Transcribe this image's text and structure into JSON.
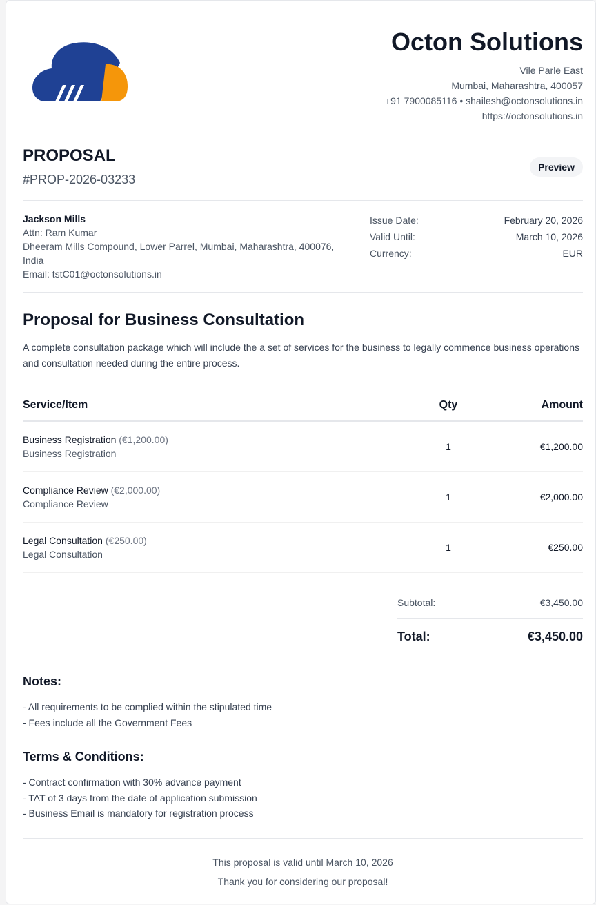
{
  "company": {
    "name": "Octon Solutions",
    "address_line1": "Vile Parle East",
    "address_line2": "Mumbai, Maharashtra, 400057",
    "contact": "+91 7900085116 • shailesh@octonsolutions.in",
    "website": "https://octonsolutions.in",
    "logo_colors": {
      "blue": "#1f4194",
      "orange": "#f5960a"
    }
  },
  "document": {
    "title": "PROPOSAL",
    "number": "#PROP-2026-03233",
    "status_badge": "Preview"
  },
  "client": {
    "name": "Jackson Mills",
    "attn": "Attn: Ram Kumar",
    "address_line1": "Dheeram Mills Compound, Lower Parrel, Mumbai, Maharashtra, 400076,",
    "address_line2": "India",
    "email": "Email: tstC01@octonsolutions.in"
  },
  "meta": [
    {
      "label": "Issue Date:",
      "value": "February 20, 2026"
    },
    {
      "label": "Valid Until:",
      "value": "March 10, 2026"
    },
    {
      "label": "Currency:",
      "value": "EUR"
    }
  ],
  "proposal": {
    "title": "Proposal for Business Consultation",
    "description": "A complete consultation package which will include the a set of services for the business to legally commence business operations and consultation needed during the entire process."
  },
  "items_table": {
    "headers": {
      "item": "Service/Item",
      "qty": "Qty",
      "amount": "Amount"
    },
    "rows": [
      {
        "name": "Business Registration",
        "price": "(€1,200.00)",
        "description": "Business Registration",
        "qty": "1",
        "amount": "€1,200.00"
      },
      {
        "name": "Compliance Review",
        "price": "(€2,000.00)",
        "description": "Compliance Review",
        "qty": "1",
        "amount": "€2,000.00"
      },
      {
        "name": "Legal Consultation",
        "price": "(€250.00)",
        "description": "Legal Consultation",
        "qty": "1",
        "amount": "€250.00"
      }
    ]
  },
  "totals": {
    "subtotal_label": "Subtotal:",
    "subtotal_value": "€3,450.00",
    "total_label": "Total:",
    "total_value": "€3,450.00"
  },
  "notes": {
    "title": "Notes:",
    "lines": [
      "- All requirements to be complied within the stipulated time",
      "- Fees include all the Government Fees"
    ]
  },
  "terms": {
    "title": "Terms & Conditions:",
    "lines": [
      "- Contract confirmation with 30% advance payment",
      "- TAT of 3 days from the date of application submission",
      "- Business Email is mandatory for registration process"
    ]
  },
  "footer": {
    "validity": "This proposal is valid until March 10, 2026",
    "thanks": "Thank you for considering our proposal!"
  }
}
